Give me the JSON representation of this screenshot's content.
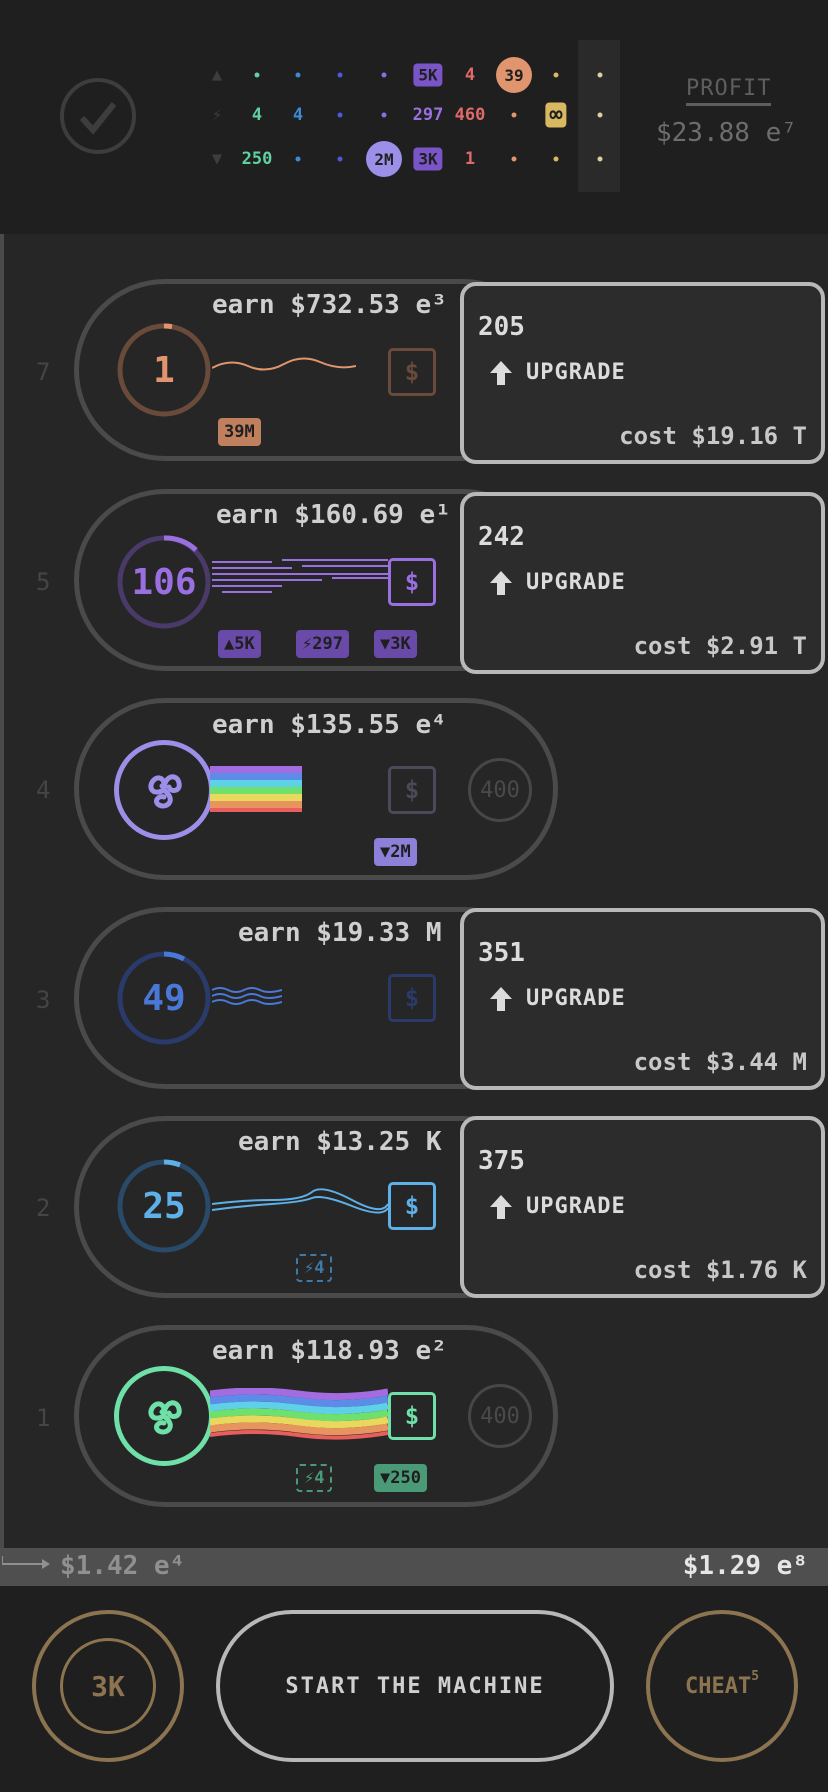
{
  "header": {
    "profit_label": "PROFIT",
    "profit_value": "$23.88 e⁷",
    "grid_rows": [
      [
        "▲",
        "•",
        "•",
        "•",
        "•",
        "5K",
        "4",
        "39",
        "•",
        "•"
      ],
      [
        "⚡",
        "4",
        "4",
        "•",
        "•",
        "297",
        "460",
        "•",
        "∞",
        "•"
      ],
      [
        "▼",
        "250",
        "•",
        "•",
        "2M",
        "3K",
        "1",
        "•",
        "•",
        "•"
      ]
    ]
  },
  "rows": [
    {
      "num": "7",
      "earn": "earn $732.53 e³",
      "ring": "1",
      "color": "#e0956e",
      "badges": [
        "39M"
      ],
      "upgrade": {
        "level": "205",
        "label": "UPGRADE",
        "cost": "cost $19.16 T"
      }
    },
    {
      "num": "5",
      "earn": "earn $160.69 e¹",
      "ring": "106",
      "color": "#9a6fe0",
      "badges": [
        "▲5K",
        "⚡297",
        "▼3K"
      ],
      "upgrade": {
        "level": "242",
        "label": "UPGRADE",
        "cost": "cost $2.91 T"
      }
    },
    {
      "num": "4",
      "earn": "earn $135.55 e⁴",
      "ring": "",
      "color": "#9b8fe8",
      "badges": [
        "▼2M"
      ],
      "side": "400"
    },
    {
      "num": "3",
      "earn": "earn $19.33 M",
      "ring": "49",
      "color": "#4a78d8",
      "badges": [],
      "upgrade": {
        "level": "351",
        "label": "UPGRADE",
        "cost": "cost $3.44 M"
      }
    },
    {
      "num": "2",
      "earn": "earn $13.25 K",
      "ring": "25",
      "color": "#5eb0e8",
      "badges": [
        "⚡4"
      ],
      "upgrade": {
        "level": "375",
        "label": "UPGRADE",
        "cost": "cost $1.76 K"
      }
    },
    {
      "num": "1",
      "earn": "earn $118.93 e²",
      "ring": "",
      "color": "#6fe0a8",
      "badges": [
        "⚡4",
        "▼250"
      ],
      "side": "400"
    }
  ],
  "bar": {
    "left": "$1.42 e⁴",
    "right": "$1.29 e⁸"
  },
  "bottom": {
    "rebirth": "3K",
    "start": "START THE MACHINE",
    "cheat": "CHEAT",
    "cheat_count": "5"
  },
  "colors": {
    "gold": "#8c7450",
    "panel": "#2c2c2c",
    "bg": "#262626"
  }
}
